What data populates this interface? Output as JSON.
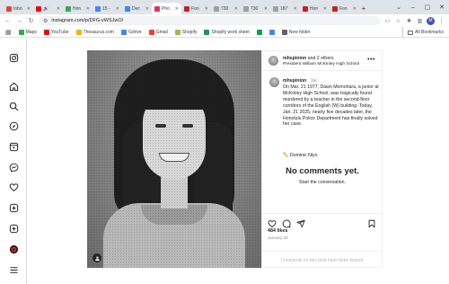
{
  "browser": {
    "tabs": [
      {
        "title": "Inbo",
        "color": "#ea4335",
        "active": false
      },
      {
        "title": "🔊",
        "color": "#ff0000",
        "active": false
      },
      {
        "title": "Hon",
        "color": "#34a853",
        "active": false
      },
      {
        "title": "15 -",
        "color": "#4285f4",
        "active": false
      },
      {
        "title": "Dec",
        "color": "#4285f4",
        "active": false
      },
      {
        "title": "Pho",
        "color": "#e1306c",
        "active": true
      },
      {
        "title": "Fon",
        "color": "#c5221f",
        "active": false
      },
      {
        "title": "730",
        "color": "#9aa0a6",
        "active": false
      },
      {
        "title": "730",
        "color": "#9aa0a6",
        "active": false
      },
      {
        "title": "187",
        "color": "#9aa0a6",
        "active": false
      },
      {
        "title": "Hon",
        "color": "#c5221f",
        "active": false
      },
      {
        "title": "Fon",
        "color": "#c5221f",
        "active": false
      }
    ],
    "new_tab": "+",
    "url": "instagram.com/p/DFG-vWSJwO/",
    "profile_initial": "M",
    "bookmarks": [
      {
        "label": "Maps",
        "color": "#34a853"
      },
      {
        "label": "YouTube",
        "color": "#ff0000"
      },
      {
        "label": "Thesaurus.com",
        "color": "#f4b400"
      },
      {
        "label": "Gdrive",
        "color": "#4285f4"
      },
      {
        "label": "Gmail",
        "color": "#ea4335"
      },
      {
        "label": "Shopify",
        "color": "#95bf47"
      },
      {
        "label": "Shopify work sheet",
        "color": "#0f9d58"
      },
      {
        "label": "",
        "color": "#0f9d58"
      },
      {
        "label": "",
        "color": "#4285f4"
      },
      {
        "label": "New folder",
        "color": "#5f6368"
      }
    ],
    "all_bookmarks": "All Bookmarks"
  },
  "post": {
    "username": "mhspinion",
    "and_others": "and 2 others",
    "location": "President William McKinley High School",
    "more": "•••",
    "caption_user": "mhspinion",
    "caption_time": "1w",
    "caption_text": "On Mar. 21 1977, Dawn Momohara, a junior at McKinley High School, was tragically found murdered by a teacher in the second-floor corridors of the English (W) building. Today, Jan. 21 2025, nearly five decades later, the Honolulu Police Department has finally solved her case.",
    "caption_tag_icon": "✏️",
    "caption_tag": "Dominic Niyo",
    "no_comments": "No comments yet.",
    "start_conversation": "Start the conversation.",
    "likes": "484 likes",
    "date": "January 22",
    "comments_limited": "Comments on this post have been limited."
  }
}
